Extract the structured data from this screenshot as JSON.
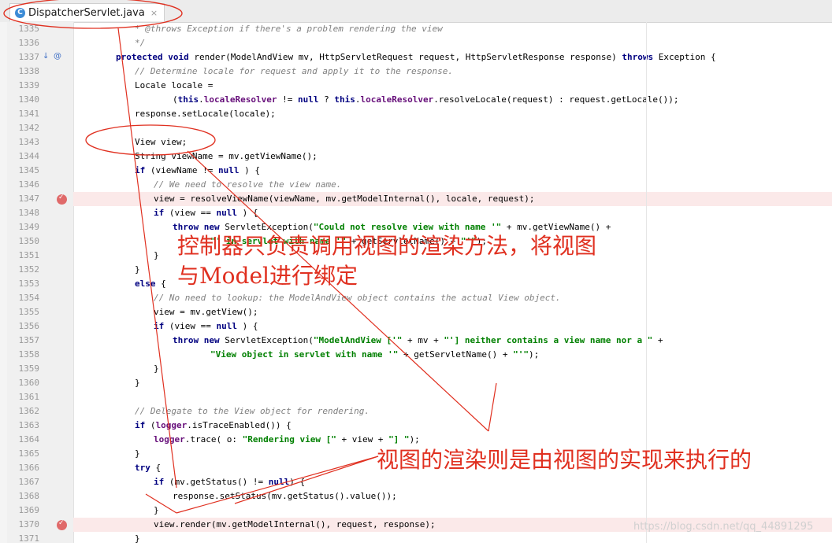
{
  "tab": {
    "icon": "java-class-icon",
    "title": "DispatcherServlet.java",
    "close": "×"
  },
  "code_lines": [
    {
      "num": "1335",
      "indent": 2,
      "segs": [
        [
          "cm",
          "* @throws Exception if there's a problem rendering the view"
        ]
      ]
    },
    {
      "num": "1336",
      "indent": 2,
      "segs": [
        [
          "cm",
          "*/"
        ]
      ]
    },
    {
      "num": "1337",
      "indent": 1,
      "segs": [
        [
          "kw",
          "protected void "
        ],
        [
          "",
          "render(ModelAndView mv, HttpServletRequest request, HttpServletResponse response) "
        ],
        [
          "kw",
          "throws "
        ],
        [
          "",
          "Exception {"
        ]
      ]
    },
    {
      "num": "1338",
      "indent": 2,
      "segs": [
        [
          "cm",
          "// Determine locale for request and apply it to the response."
        ]
      ]
    },
    {
      "num": "1339",
      "indent": 2,
      "segs": [
        [
          "",
          "Locale locale ="
        ]
      ]
    },
    {
      "num": "1340",
      "indent": 4,
      "segs": [
        [
          "",
          "("
        ],
        [
          "kw",
          "this"
        ],
        [
          "",
          "."
        ],
        [
          "fld",
          "localeResolver"
        ],
        [
          "",
          " != "
        ],
        [
          "kw",
          "null"
        ],
        [
          "",
          " ? "
        ],
        [
          "kw",
          "this"
        ],
        [
          "",
          "."
        ],
        [
          "fld",
          "localeResolver"
        ],
        [
          "",
          ".resolveLocale(request) : request.getLocale());"
        ]
      ]
    },
    {
      "num": "1341",
      "indent": 2,
      "segs": [
        [
          "",
          "response.setLocale(locale);"
        ]
      ]
    },
    {
      "num": "1342",
      "indent": 0,
      "segs": []
    },
    {
      "num": "1343",
      "indent": 2,
      "segs": [
        [
          "",
          "View view;"
        ]
      ]
    },
    {
      "num": "1344",
      "indent": 2,
      "segs": [
        [
          "",
          "String viewName = mv.getViewName();"
        ]
      ]
    },
    {
      "num": "1345",
      "indent": 2,
      "segs": [
        [
          "kw",
          "if "
        ],
        [
          "",
          "(viewName != "
        ],
        [
          "kw",
          "null"
        ],
        [
          "",
          " ) {"
        ]
      ]
    },
    {
      "num": "1346",
      "indent": 3,
      "segs": [
        [
          "cm",
          "// We need to resolve the view name."
        ]
      ]
    },
    {
      "num": "1347",
      "indent": 3,
      "segs": [
        [
          "",
          "view = resolveViewName(viewName, mv.getModelInternal(), locale, request);"
        ]
      ]
    },
    {
      "num": "1348",
      "indent": 3,
      "segs": [
        [
          "kw",
          "if "
        ],
        [
          "",
          "(view == "
        ],
        [
          "kw",
          "null"
        ],
        [
          "",
          " ) {"
        ]
      ]
    },
    {
      "num": "1349",
      "indent": 4,
      "segs": [
        [
          "kw",
          "throw new "
        ],
        [
          "",
          "ServletException("
        ],
        [
          "str",
          "\"Could not resolve view with name '\""
        ],
        [
          "",
          " + mv.getViewName() +"
        ]
      ]
    },
    {
      "num": "1350",
      "indent": 6,
      "segs": [
        [
          "str",
          "\"' in servlet with name '\""
        ],
        [
          "",
          " + getServletName() + "
        ],
        [
          "str",
          "\"'\""
        ],
        [
          "",
          ");"
        ]
      ]
    },
    {
      "num": "1351",
      "indent": 3,
      "segs": [
        [
          "",
          "}"
        ]
      ]
    },
    {
      "num": "1352",
      "indent": 2,
      "segs": [
        [
          "",
          "}"
        ]
      ]
    },
    {
      "num": "1353",
      "indent": 2,
      "segs": [
        [
          "kw",
          "else "
        ],
        [
          "",
          "{"
        ]
      ]
    },
    {
      "num": "1354",
      "indent": 3,
      "segs": [
        [
          "cm",
          "// No need to lookup: the ModelAndView object contains the actual View object."
        ]
      ]
    },
    {
      "num": "1355",
      "indent": 3,
      "segs": [
        [
          "",
          "view = mv.getView();"
        ]
      ]
    },
    {
      "num": "1356",
      "indent": 3,
      "segs": [
        [
          "kw",
          "if "
        ],
        [
          "",
          "(view == "
        ],
        [
          "kw",
          "null"
        ],
        [
          "",
          " ) {"
        ]
      ]
    },
    {
      "num": "1357",
      "indent": 4,
      "segs": [
        [
          "kw",
          "throw new "
        ],
        [
          "",
          "ServletException("
        ],
        [
          "str",
          "\"ModelAndView ['\""
        ],
        [
          "",
          " + mv + "
        ],
        [
          "str",
          "\"'] neither contains a view name nor a \""
        ],
        [
          "",
          " +"
        ]
      ]
    },
    {
      "num": "1358",
      "indent": 6,
      "segs": [
        [
          "str",
          "\"View object in servlet with name '\""
        ],
        [
          "",
          " + getServletName() + "
        ],
        [
          "str",
          "\"'\""
        ],
        [
          "",
          ");"
        ]
      ]
    },
    {
      "num": "1359",
      "indent": 3,
      "segs": [
        [
          "",
          "}"
        ]
      ]
    },
    {
      "num": "1360",
      "indent": 2,
      "segs": [
        [
          "",
          "}"
        ]
      ]
    },
    {
      "num": "1361",
      "indent": 0,
      "segs": []
    },
    {
      "num": "1362",
      "indent": 2,
      "segs": [
        [
          "cm",
          "// Delegate to the View object for rendering."
        ]
      ]
    },
    {
      "num": "1363",
      "indent": 2,
      "segs": [
        [
          "kw",
          "if "
        ],
        [
          "",
          "("
        ],
        [
          "fld",
          "logger"
        ],
        [
          "",
          ".isTraceEnabled()) {"
        ]
      ]
    },
    {
      "num": "1364",
      "indent": 3,
      "segs": [
        [
          "fld",
          "logger"
        ],
        [
          "",
          ".trace( o: "
        ],
        [
          "str",
          "\"Rendering view [\""
        ],
        [
          "",
          " + view + "
        ],
        [
          "str",
          "\"] \""
        ],
        [
          "",
          ");"
        ]
      ]
    },
    {
      "num": "1365",
      "indent": 2,
      "segs": [
        [
          "",
          "}"
        ]
      ]
    },
    {
      "num": "1366",
      "indent": 2,
      "segs": [
        [
          "kw",
          "try "
        ],
        [
          "",
          "{"
        ]
      ]
    },
    {
      "num": "1367",
      "indent": 3,
      "segs": [
        [
          "kw",
          "if "
        ],
        [
          "",
          "(mv.getStatus() != "
        ],
        [
          "kw",
          "null"
        ],
        [
          "",
          ") {"
        ]
      ]
    },
    {
      "num": "1368",
      "indent": 4,
      "segs": [
        [
          "",
          "response.setStatus(mv.getStatus().value());"
        ]
      ]
    },
    {
      "num": "1369",
      "indent": 3,
      "segs": [
        [
          "",
          "}"
        ]
      ]
    },
    {
      "num": "1370",
      "indent": 3,
      "segs": [
        [
          "",
          "view.render(mv.getModelInternal(), request, response);"
        ]
      ]
    },
    {
      "num": "1371",
      "indent": 2,
      "segs": [
        [
          "",
          "}"
        ]
      ]
    }
  ],
  "breakpoint_lines": [
    "1347",
    "1370"
  ],
  "gutter_markers": {
    "line": "1337",
    "icons": [
      "override-icon",
      "annotation-icon"
    ],
    "symbols": [
      "↓",
      "@"
    ]
  },
  "annotations": {
    "top_line1": "控制器只负责调用视图的渲染方法，将视图",
    "top_line2": "与Model进行绑定",
    "bottom": "视图的渲染则是由视图的实现来执行的"
  },
  "watermark": "https://blog.csdn.net/qq_44891295",
  "colors": {
    "annotation": "#e03020",
    "breakpoint_bg": "#fbe9e9",
    "keyword": "#000080",
    "comment": "#808080",
    "string": "#008000",
    "field": "#660e7a"
  }
}
